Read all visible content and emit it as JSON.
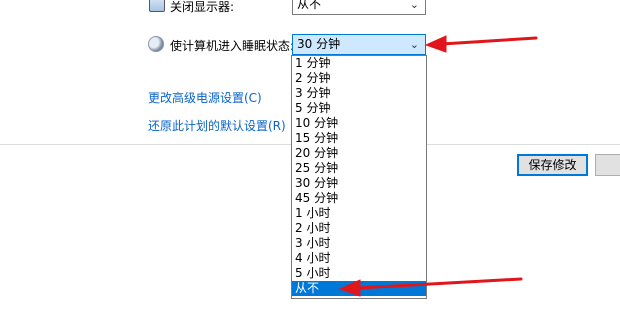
{
  "display_off": {
    "label": "关闭显示器:",
    "value": "从不"
  },
  "sleep": {
    "label": "使计算机进入睡眠状态:",
    "value": "30 分钟",
    "options": [
      "1 分钟",
      "2 分钟",
      "3 分钟",
      "5 分钟",
      "10 分钟",
      "15 分钟",
      "20 分钟",
      "25 分钟",
      "30 分钟",
      "45 分钟",
      "1 小时",
      "2 小时",
      "3 小时",
      "4 小时",
      "5 小时",
      "从不"
    ],
    "highlighted_option": "从不"
  },
  "links": {
    "advanced": "更改高级电源设置(C)",
    "restore": "还原此计划的默认设置(R)"
  },
  "buttons": {
    "save": "保存修改"
  },
  "colors": {
    "accent": "#0078d7",
    "link": "#0a63c9",
    "arrow": "#e0161b"
  },
  "icons": {
    "display": "monitor-icon",
    "sleep": "moon-icon",
    "dropdown": "chevron-down-icon"
  }
}
